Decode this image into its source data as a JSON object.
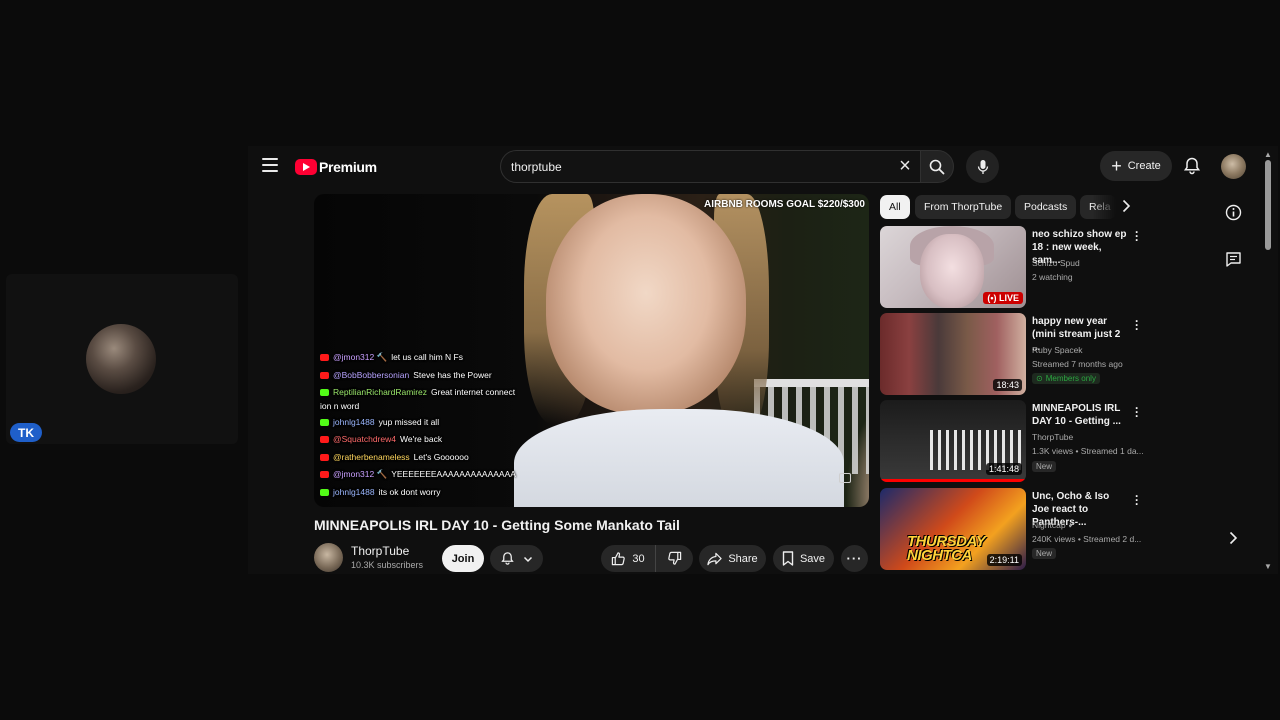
{
  "webcam": {
    "badge": "TK"
  },
  "header": {
    "logo_text": "Premium",
    "search_value": "thorptube",
    "create_label": "Create"
  },
  "player": {
    "overlay_goal": "AIRBNB ROOMS GOAL $220/$300",
    "chat": [
      {
        "platform": "youtube",
        "user": "@jmon312 🔨",
        "user_color": "#c9a0ff",
        "msg": "let us call him N Fs"
      },
      {
        "platform": "youtube",
        "user": "@BobBobbersonian",
        "user_color": "#b7a3ff",
        "msg": "Steve has the Power"
      },
      {
        "platform": "kick",
        "user": "ReptilianRichardRamirez",
        "user_color": "#9be86b",
        "msg": "Great internet connect"
      },
      {
        "platform": "none",
        "user": "",
        "user_color": "#ffffff",
        "msg": "ion n word"
      },
      {
        "platform": "kick",
        "user": "johnlg1488",
        "user_color": "#9bb7ff",
        "msg": "yup missed it all"
      },
      {
        "platform": "youtube",
        "user": "@Squatchdrew4",
        "user_color": "#ff6b6b",
        "msg": "We're back"
      },
      {
        "platform": "youtube",
        "user": "@ratherbenameless",
        "user_color": "#ffd75e",
        "msg": "Let's Goooooo"
      },
      {
        "platform": "youtube",
        "user": "@jmon312 🔨",
        "user_color": "#c9a0ff",
        "msg": "YEEEEEEEAAAAAAAAAAAAAA"
      },
      {
        "platform": "kick",
        "user": "johnlg1488",
        "user_color": "#9bb7ff",
        "msg": "its ok dont worry"
      }
    ]
  },
  "video": {
    "title": "MINNEAPOLIS IRL DAY 10 - Getting Some Mankato Tail",
    "channel_name": "ThorpTube",
    "subscribers": "10.3K subscribers",
    "join_label": "Join",
    "like_count": "30",
    "share_label": "Share",
    "save_label": "Save"
  },
  "chips": [
    "All",
    "From ThorpTube",
    "Podcasts",
    "Rela"
  ],
  "recommendations": [
    {
      "title": "neo schizo show ep 18 : new week, sam...",
      "channel": "Schizo Spud",
      "meta": "2 watching",
      "badge": "LIVE"
    },
    {
      "title": "happy new year (mini stream just 2 ...",
      "channel": "Ruby Spacek",
      "meta": "Streamed 7 months ago",
      "badge": "Members only",
      "duration": "18:43"
    },
    {
      "title": "MINNEAPOLIS IRL DAY 10 - Getting ...",
      "channel": "ThorpTube",
      "meta": "1.3K views • Streamed 1 da...",
      "badge": "New",
      "duration": "1:41:48"
    },
    {
      "title": "Unc, Ocho & Iso Joe react to Panthers-...",
      "channel": "Nightcap",
      "meta": "240K views • Streamed 2 d...",
      "badge": "New",
      "duration": "2:19:11",
      "thumb_text_1": "THURSDAY",
      "thumb_text_2": "NIGHTCA"
    }
  ],
  "colors": {
    "brand_red": "#ff0033",
    "background": "#0f0f0f",
    "chip_bg": "#272727"
  }
}
